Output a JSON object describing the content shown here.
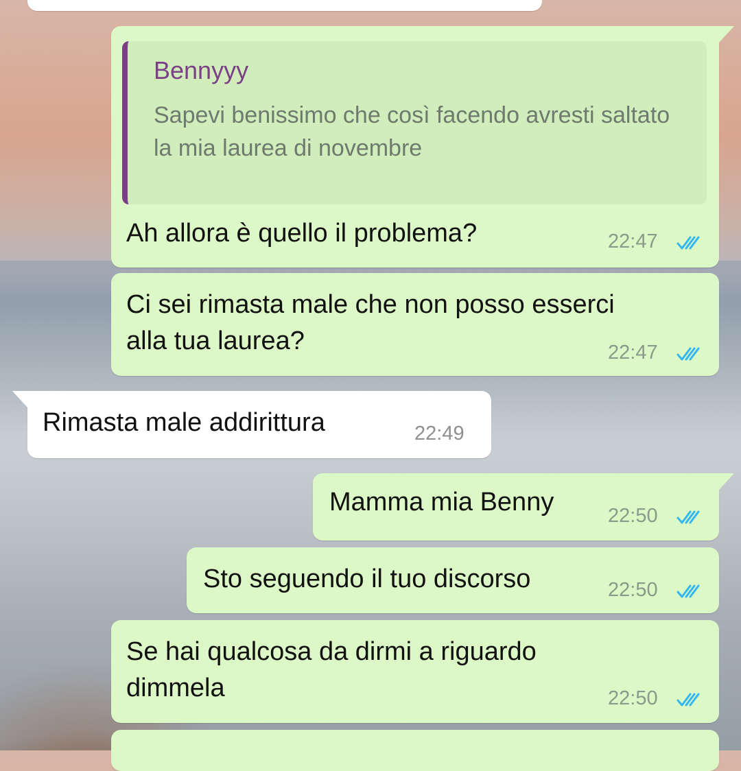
{
  "colors": {
    "outgoing_bubble": "#dcf8c6",
    "incoming_bubble": "#ffffff",
    "quote_accent": "#7b3f86",
    "read_ticks": "#34b7f1"
  },
  "quote": {
    "author": "Bennyyy",
    "text": "Sapevi benissimo che così facendo avresti saltato la mia laurea di novembre"
  },
  "messages": [
    {
      "direction": "out",
      "text": "Ah allora è quello il problema?",
      "time": "22:47",
      "status": "read-double-check-icon"
    },
    {
      "direction": "out",
      "text": "Ci sei rimasta male che non posso esserci alla tua laurea?",
      "time": "22:47",
      "status": "read-double-check-icon"
    },
    {
      "direction": "in",
      "text": "Rimasta male addirittura",
      "time": "22:49"
    },
    {
      "direction": "out",
      "text": "Mamma mia Benny",
      "time": "22:50",
      "status": "read-double-check-icon"
    },
    {
      "direction": "out",
      "text": "Sto seguendo il tuo discorso",
      "time": "22:50",
      "status": "read-double-check-icon"
    },
    {
      "direction": "out",
      "text": "Se hai qualcosa da dirmi a riguardo dimmela",
      "time": "22:50",
      "status": "read-double-check-icon"
    }
  ]
}
